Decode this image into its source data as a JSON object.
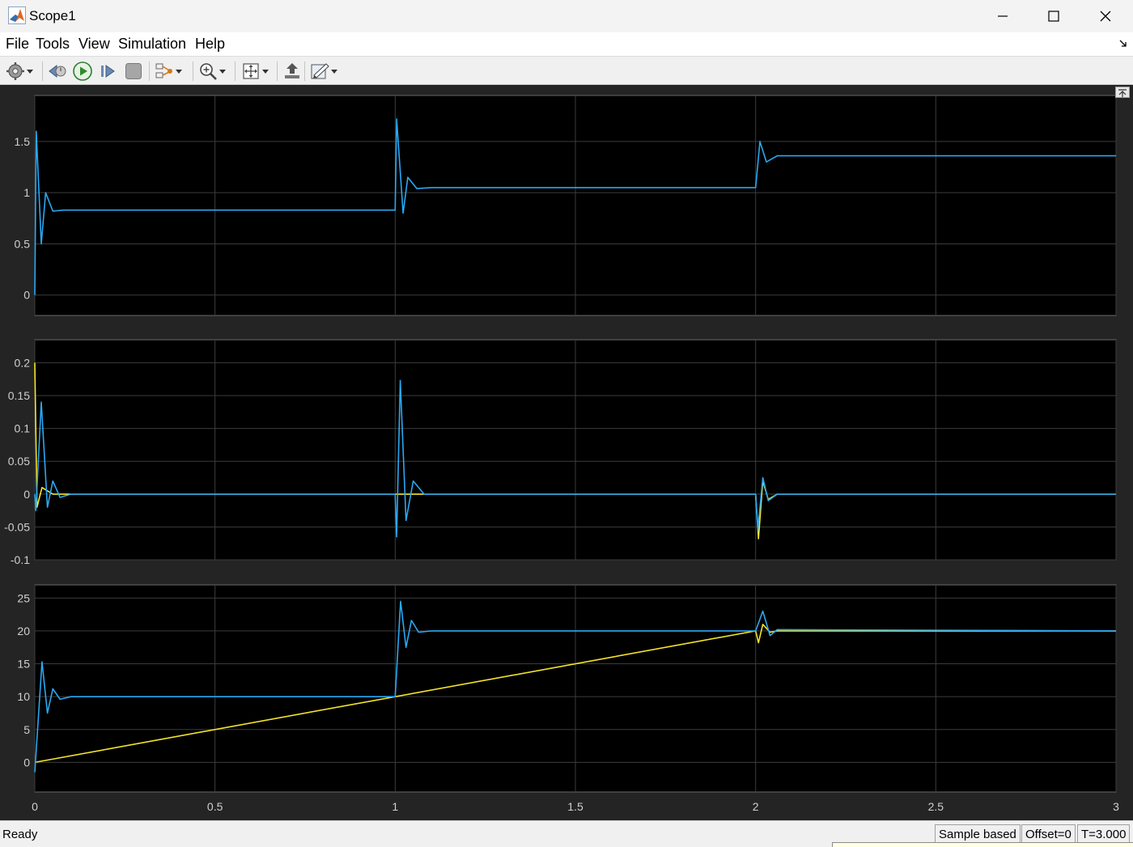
{
  "window": {
    "title": "Scope1"
  },
  "menu": {
    "items": [
      "File",
      "Tools",
      "View",
      "Simulation",
      "Help"
    ]
  },
  "toolbar": {
    "buttons": [
      "gear-icon",
      "step-back-icon",
      "run-icon",
      "step-forward-icon",
      "stop-icon",
      "signal-selection-icon",
      "zoom-icon",
      "autoscale-icon",
      "restore-layout-icon",
      "measurement-icon"
    ]
  },
  "colors": {
    "series_blue": "#2aa8f2",
    "series_yellow": "#f5e52a",
    "axes_bg": "#000000",
    "figure_bg": "#242424",
    "grid": "#3c3c3c"
  },
  "chart_data": [
    {
      "type": "line",
      "xlim": [
        0,
        3
      ],
      "ylim": [
        -0.2,
        1.95
      ],
      "yticks": [
        "0",
        "0.5",
        "1",
        "1.5"
      ],
      "grid": true,
      "series": [
        {
          "color": "#2aa8f2",
          "points": [
            [
              0,
              0
            ],
            [
              0.004,
              1.6
            ],
            [
              0.018,
              0.5
            ],
            [
              0.03,
              1.0
            ],
            [
              0.05,
              0.82
            ],
            [
              0.08,
              0.83
            ],
            [
              1.0,
              0.83
            ],
            [
              1.004,
              1.72
            ],
            [
              1.022,
              0.8
            ],
            [
              1.035,
              1.15
            ],
            [
              1.06,
              1.04
            ],
            [
              1.1,
              1.05
            ],
            [
              2.0,
              1.05
            ],
            [
              2.012,
              1.5
            ],
            [
              2.03,
              1.3
            ],
            [
              2.06,
              1.36
            ],
            [
              3.0,
              1.36
            ]
          ]
        }
      ]
    },
    {
      "type": "line",
      "xlim": [
        0,
        3
      ],
      "ylim": [
        -0.1,
        0.235
      ],
      "yticks": [
        "-0.1",
        "-0.05",
        "0",
        "0.05",
        "0.1",
        "0.15",
        "0.2"
      ],
      "grid": true,
      "series": [
        {
          "color": "#f5e52a",
          "points": [
            [
              0,
              0.2
            ],
            [
              0.006,
              -0.02
            ],
            [
              0.02,
              0.01
            ],
            [
              0.05,
              0
            ],
            [
              2.0,
              0
            ],
            [
              2.008,
              -0.068
            ],
            [
              2.02,
              0.02
            ],
            [
              2.035,
              -0.008
            ],
            [
              2.06,
              0
            ],
            [
              3.0,
              0
            ]
          ]
        },
        {
          "color": "#2aa8f2",
          "points": [
            [
              0,
              0
            ],
            [
              0.003,
              -0.025
            ],
            [
              0.018,
              0.14
            ],
            [
              0.035,
              -0.02
            ],
            [
              0.05,
              0.02
            ],
            [
              0.07,
              -0.005
            ],
            [
              0.1,
              0
            ],
            [
              1.0,
              0
            ],
            [
              1.004,
              -0.065
            ],
            [
              1.014,
              0.173
            ],
            [
              1.03,
              -0.04
            ],
            [
              1.05,
              0.02
            ],
            [
              1.08,
              0
            ],
            [
              2.0,
              0
            ],
            [
              2.006,
              -0.055
            ],
            [
              2.02,
              0.025
            ],
            [
              2.035,
              -0.01
            ],
            [
              2.06,
              0
            ],
            [
              3.0,
              0
            ]
          ]
        }
      ]
    },
    {
      "type": "line",
      "xlim": [
        0,
        3
      ],
      "ylim": [
        -4.5,
        27
      ],
      "yticks": [
        "0",
        "5",
        "10",
        "15",
        "20",
        "25"
      ],
      "xticks": [
        "0",
        "0.5",
        "1",
        "1.5",
        "2",
        "2.5",
        "3"
      ],
      "grid": true,
      "series": [
        {
          "color": "#f5e52a",
          "points": [
            [
              0,
              0
            ],
            [
              2.0,
              20
            ],
            [
              2.008,
              18.2
            ],
            [
              2.02,
              21
            ],
            [
              2.04,
              19.8
            ],
            [
              2.06,
              20
            ],
            [
              3.0,
              20
            ]
          ]
        },
        {
          "color": "#2aa8f2",
          "points": [
            [
              0,
              -1.5
            ],
            [
              0.02,
              15.3
            ],
            [
              0.035,
              7.5
            ],
            [
              0.05,
              11.2
            ],
            [
              0.07,
              9.6
            ],
            [
              0.1,
              10
            ],
            [
              1.0,
              10
            ],
            [
              1.015,
              24.5
            ],
            [
              1.03,
              17.5
            ],
            [
              1.045,
              21.6
            ],
            [
              1.065,
              19.8
            ],
            [
              1.1,
              20
            ],
            [
              2.0,
              20
            ],
            [
              2.02,
              23
            ],
            [
              2.04,
              19.3
            ],
            [
              2.06,
              20.2
            ],
            [
              3.0,
              20
            ]
          ]
        }
      ]
    }
  ],
  "status": {
    "ready": "Ready",
    "sample_mode": "Sample based",
    "offset": "Offset=0",
    "time": "T=3.000"
  }
}
